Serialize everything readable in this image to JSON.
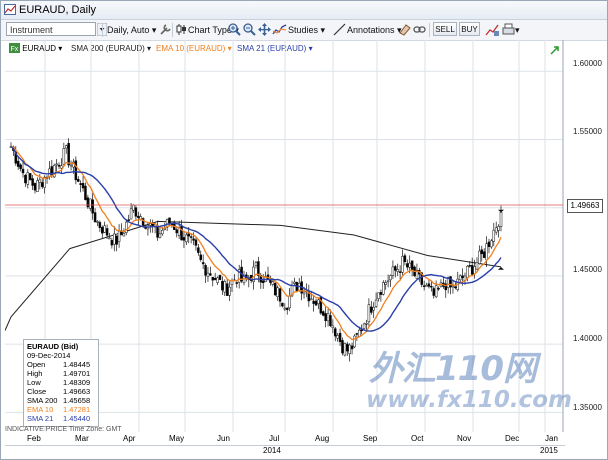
{
  "window": {
    "title": "EURAUD, Daily"
  },
  "toolbar": {
    "instrument_placeholder": "Instrument",
    "period": "Daily, Auto",
    "chart_type": "Chart Type",
    "studies": "Studies",
    "annotations": "Annotations",
    "sell": "SELL",
    "buy": "BUY"
  },
  "legend": {
    "symbol": "EURAUD",
    "sma200": "SMA 200 (EURAUD)",
    "ema10": "EMA 10 (EURAUD)",
    "sma21": "SMA 21 (EURAUD)"
  },
  "colors": {
    "candle_up": "#ffffff",
    "candle_down": "#000000",
    "sma200": "#222222",
    "ema10": "#f08020",
    "sma21": "#2a3fa8",
    "watermark": "#3e6ab0",
    "current_line": "#e05050"
  },
  "info": {
    "title": "EURAUD (Bid)",
    "date": "09-Dec-2014",
    "rows": [
      {
        "label": "Open",
        "value": "1.48445"
      },
      {
        "label": "High",
        "value": "1.49701"
      },
      {
        "label": "Low",
        "value": "1.48309"
      },
      {
        "label": "Close",
        "value": "1.49663"
      },
      {
        "label": "SMA 200",
        "value": "1.45658"
      },
      {
        "label": "EMA 10",
        "value": "1.47281"
      },
      {
        "label": "SMA 21",
        "value": "1.45440"
      }
    ]
  },
  "footer": "INDICATIVE PRICE  Time Zone: GMT",
  "watermark": {
    "cn": "外汇110网",
    "url": "www.fx110.com"
  },
  "current_price": "1.49663",
  "chart_data": {
    "type": "candlestick",
    "title": "EURAUD, Daily",
    "year": "2014",
    "x_months": [
      "Feb",
      "Mar",
      "Apr",
      "May",
      "Jun",
      "Jul",
      "Aug",
      "Sep",
      "Oct",
      "Nov",
      "Dec",
      "Jan",
      "2015"
    ],
    "y_ticks": [
      "1.60000",
      "1.55000",
      "1.50000",
      "1.45000",
      "1.40000",
      "1.35000"
    ],
    "ylim": [
      1.34,
      1.62
    ],
    "close_path": [
      1.545,
      1.535,
      1.525,
      1.52,
      1.515,
      1.52,
      1.525,
      1.53,
      1.535,
      1.54,
      1.53,
      1.52,
      1.51,
      1.5,
      1.49,
      1.485,
      1.48,
      1.475,
      1.48,
      1.49,
      1.5,
      1.495,
      1.49,
      1.485,
      1.48,
      1.485,
      1.49,
      1.485,
      1.48,
      1.475,
      1.47,
      1.46,
      1.455,
      1.45,
      1.445,
      1.44,
      1.445,
      1.45,
      1.445,
      1.45,
      1.455,
      1.45,
      1.445,
      1.44,
      1.435,
      1.43,
      1.44,
      1.445,
      1.44,
      1.435,
      1.43,
      1.425,
      1.42,
      1.41,
      1.4,
      1.395,
      1.4,
      1.41,
      1.42,
      1.43,
      1.44,
      1.445,
      1.45,
      1.455,
      1.46,
      1.455,
      1.45,
      1.445,
      1.44,
      1.435,
      1.44,
      1.445,
      1.44,
      1.445,
      1.45,
      1.455,
      1.46,
      1.465,
      1.475,
      1.485,
      1.4966
    ],
    "series": [
      {
        "name": "SMA 200",
        "points": [
          [
            0,
            1.42
          ],
          [
            0.12,
            1.47
          ],
          [
            0.3,
            1.49
          ],
          [
            0.55,
            1.487
          ],
          [
            0.7,
            1.48
          ],
          [
            0.85,
            1.465
          ],
          [
            1.0,
            1.4566
          ]
        ]
      },
      {
        "name": "EMA 10",
        "values": "derived from close_path",
        "last": 1.47281
      },
      {
        "name": "SMA 21",
        "values": "derived from close_path",
        "last": 1.4544
      }
    ],
    "last_values": {
      "open": 1.48445,
      "high": 1.49701,
      "low": 1.48309,
      "close": 1.49663
    }
  }
}
